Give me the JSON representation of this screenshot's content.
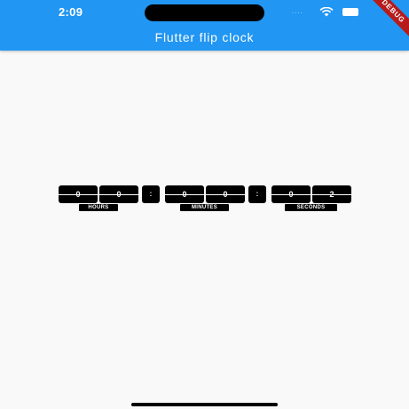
{
  "status_bar": {
    "time": "2:09",
    "signal": "....",
    "icons": [
      "wifi-icon",
      "battery-icon"
    ]
  },
  "debug_banner": "DEBUG",
  "app_bar": {
    "title": "Flutter flip clock",
    "color": "#2196f3"
  },
  "clock": {
    "digits": [
      "0",
      "0",
      "0",
      "0",
      "0",
      "2"
    ],
    "separators": [
      ":",
      ":"
    ],
    "labels": [
      "HOURS",
      "MINUTES",
      "SECONDS"
    ]
  }
}
